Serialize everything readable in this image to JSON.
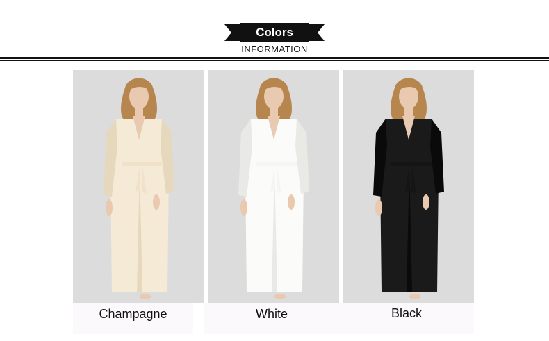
{
  "header": {
    "title": "Colors",
    "subtitle": "INFORMATION"
  },
  "products": [
    {
      "color_name": "Champagne",
      "robe_color": "#f4ead6",
      "robe_shade": "#e6d8bd",
      "belt_color": "#efe2c9"
    },
    {
      "color_name": "White",
      "robe_color": "#fbfbf9",
      "robe_shade": "#e9e9e6",
      "belt_color": "#f5f5f2"
    },
    {
      "color_name": "Black",
      "robe_color": "#1a1a1a",
      "robe_shade": "#0a0a0a",
      "belt_color": "#151515"
    }
  ],
  "colors": {
    "banner": "#111111",
    "panel_bg": "#dcdcdc",
    "hair": "#b7864f",
    "skin": "#e9c9b0"
  }
}
